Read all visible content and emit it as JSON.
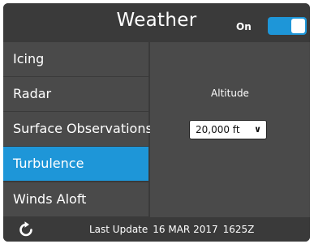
{
  "header": {
    "title": "Weather",
    "toggle_label": "On",
    "toggle_on": true
  },
  "menu": {
    "items": [
      {
        "label": "Icing",
        "selected": false
      },
      {
        "label": "Radar",
        "selected": false
      },
      {
        "label": "Surface Observations",
        "selected": false
      },
      {
        "label": "Turbulence",
        "selected": true
      },
      {
        "label": "Winds Aloft",
        "selected": false
      }
    ]
  },
  "detail": {
    "altitude_label": "Altitude",
    "altitude_value": "20,000 ft"
  },
  "footer": {
    "refresh_icon": "refresh-icon",
    "last_update_label": "Last Update",
    "last_update_date": "16 MAR 2017",
    "last_update_time": "1625Z"
  },
  "colors": {
    "accent": "#1e96d8",
    "panel": "#4a4a4a",
    "frame": "#3a3a3a"
  }
}
